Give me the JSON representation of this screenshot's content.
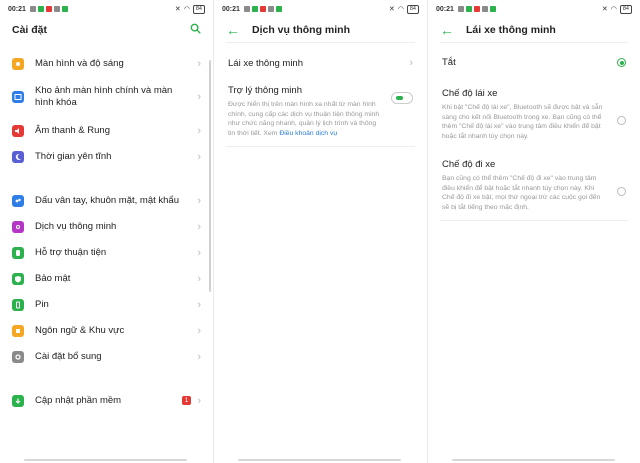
{
  "status": {
    "time": "00:21",
    "battery": "84"
  },
  "screen1": {
    "title": "Cài đặt",
    "items": [
      {
        "label": "Màn hình và độ sáng",
        "icon": "sun-icon",
        "color": "#f5a623"
      },
      {
        "label": "Kho ảnh màn hình chính và màn hình khóa",
        "icon": "image-icon",
        "color": "#2f7ee8"
      },
      {
        "label": "Âm thanh & Rung",
        "icon": "speaker-icon",
        "color": "#e53935"
      },
      {
        "label": "Thời gian yên tĩnh",
        "icon": "moon-icon",
        "color": "#5b5fd6"
      },
      {
        "label": "Dấu vân tay, khuôn mặt, mật khẩu",
        "icon": "fingerprint-icon",
        "color": "#2f7ee8"
      },
      {
        "label": "Dịch vụ thông minh",
        "icon": "smart-service-icon",
        "color": "#b535c7"
      },
      {
        "label": "Hỗ trợ thuận tiện",
        "icon": "hand-icon",
        "color": "#2bb24c"
      },
      {
        "label": "Bảo mật",
        "icon": "shield-icon",
        "color": "#2bb24c"
      },
      {
        "label": "Pin",
        "icon": "battery-icon",
        "color": "#2bb24c"
      },
      {
        "label": "Ngôn ngữ & Khu vực",
        "icon": "globe-icon",
        "color": "#f5a623"
      },
      {
        "label": "Cài đặt bổ sung",
        "icon": "more-settings-icon",
        "color": "#8a8a8a"
      },
      {
        "label": "Cập nhật phần mềm",
        "icon": "update-icon",
        "color": "#2bb24c",
        "badge": "1"
      }
    ]
  },
  "screen2": {
    "title": "Dịch vụ thông minh",
    "drive_label": "Lái xe thông minh",
    "assistant_title": "Trợ lý thông minh",
    "assistant_desc": "Được hiển thị trên màn hình xa nhất từ màn hình chính, cung cấp các dịch vụ thuận tiện thông minh như chức năng nhanh, quản lý lịch trình và thông tin thời tiết. Xem ",
    "assistant_link": "Điều khoản dịch vụ"
  },
  "screen3": {
    "title": "Lái xe thông minh",
    "off_label": "Tắt",
    "drive_mode_title": "Chế độ lái xe",
    "drive_mode_desc": "Khi bật \"Chế độ lái xe\", Bluetooth sẽ được bật và sẵn sàng cho kết nối Bluetooth trong xe. Bạn cũng có thể thêm \"Chế độ lái xe\" vào trung tâm điều khiển để bật hoặc tắt nhanh tùy chọn này.",
    "ride_mode_title": "Chế độ đi xe",
    "ride_mode_desc": "Bạn cũng có thể thêm \"Chế độ đi xe\" vào trung tâm điều khiển để bật hoặc tắt nhanh tùy chọn này. Khi Chế độ đi xe bật, mọi thứ ngoại trừ các cuộc gọi đến sẽ bị tắt tiếng theo mặc định."
  },
  "accent": "#2bb24c"
}
